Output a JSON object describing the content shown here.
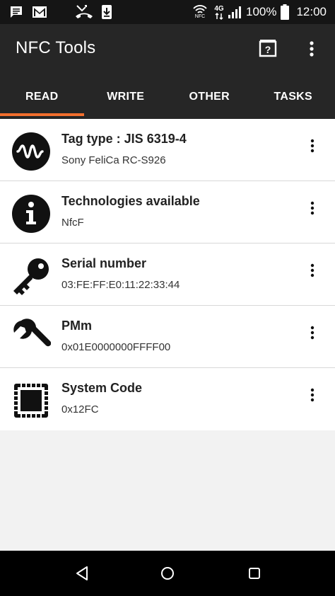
{
  "status_bar": {
    "network_label": "4G",
    "nfc_label": "NFC",
    "battery": "100%",
    "time": "12:00",
    "icons": [
      "message-icon",
      "gmail-icon",
      "missed-call-icon",
      "download-icon",
      "nfc-icon",
      "signal-icon",
      "battery-icon"
    ]
  },
  "app_bar": {
    "title": "NFC Tools",
    "help_icon": "help-book-icon",
    "more_icon": "more-vert-icon"
  },
  "tabs": [
    {
      "label": "READ",
      "active": true
    },
    {
      "label": "WRITE",
      "active": false
    },
    {
      "label": "OTHER",
      "active": false
    },
    {
      "label": "TASKS",
      "active": false
    }
  ],
  "accent_color": "#f36f2e",
  "rows": [
    {
      "icon": "wave-icon",
      "title": "Tag type : JIS 6319-4",
      "value": "Sony FeliCa RC-S926"
    },
    {
      "icon": "info-icon",
      "title": "Technologies available",
      "value": "NfcF"
    },
    {
      "icon": "key-icon",
      "title": "Serial number",
      "value": "03:FE:FF:E0:11:22:33:44"
    },
    {
      "icon": "wrench-icon",
      "title": "PMm",
      "value": "0x01E0000000FFFF00"
    },
    {
      "icon": "chip-icon",
      "title": "System Code",
      "value": "0x12FC"
    }
  ],
  "nav_bar": {
    "back": "back-icon",
    "home": "home-icon",
    "recents": "recents-icon"
  }
}
